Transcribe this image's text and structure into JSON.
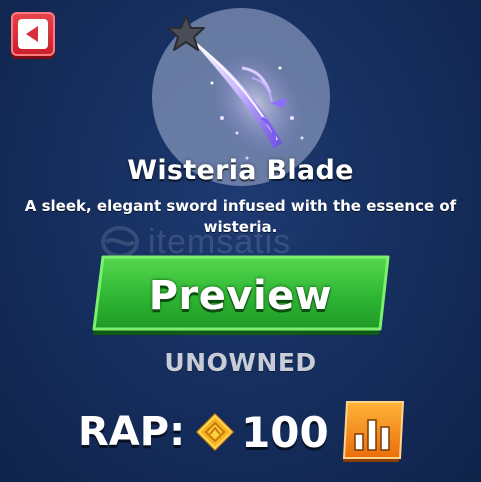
{
  "item": {
    "name": "Wisteria Blade",
    "description": "A sleek, elegant sword infused with the essence of wisteria.",
    "status": "UNOWNED"
  },
  "actions": {
    "preview_label": "Preview"
  },
  "rap": {
    "label": "RAP:",
    "value": "100"
  },
  "watermark": {
    "text": "itemsatis"
  },
  "icons": {
    "back": "back-arrow-icon",
    "star": "star-icon",
    "coin": "coin-icon",
    "chart": "bar-chart-icon"
  },
  "colors": {
    "background": "#152d5c",
    "back_button": "#d8303a",
    "preview_button": "#2fb634",
    "status_text": "#c7ccd6",
    "coin": "#f5b21c",
    "chart_button": "#f08a14",
    "star": "#4a4d55"
  }
}
